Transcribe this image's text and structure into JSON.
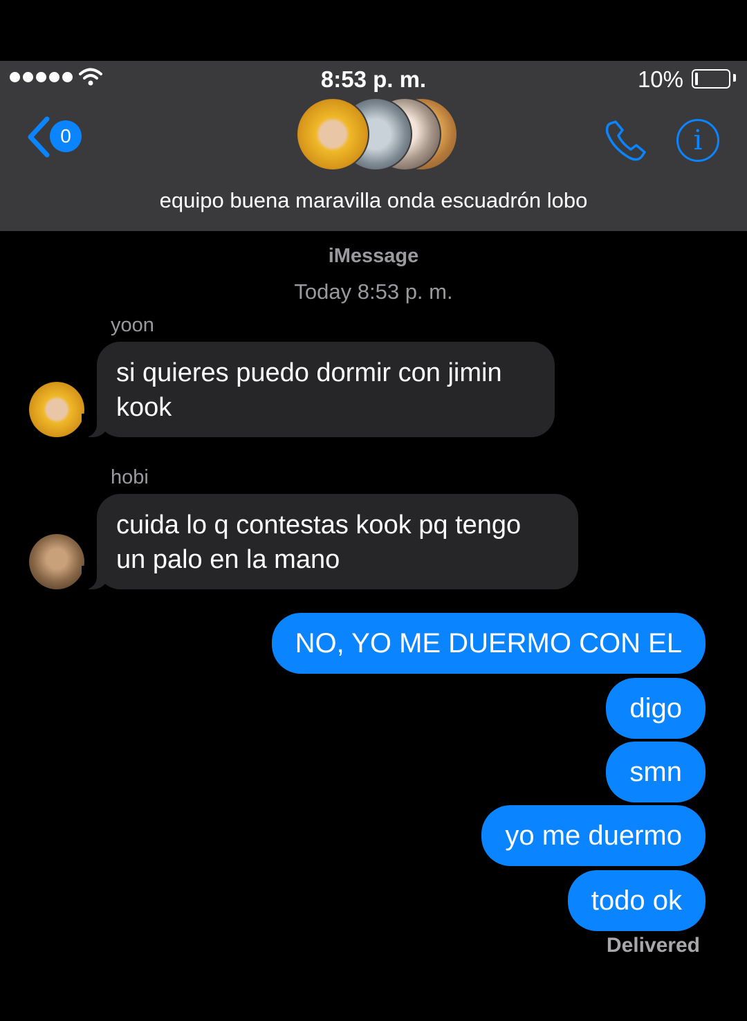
{
  "status_bar": {
    "time": "8:53 p. m.",
    "battery": "10%"
  },
  "nav": {
    "back_count": "0",
    "group_name": "equipo buena maravilla onda escuadrón lobo"
  },
  "conversation": {
    "service": "iMessage",
    "timestamp": "Today 8:53 p. m.",
    "incoming": [
      {
        "sender": "yoon",
        "text_line1": "si quieres puedo dormir con jimin",
        "text_line2": "kook"
      },
      {
        "sender": "hobi",
        "text_line1": "cuida lo q contestas kook pq tengo",
        "text_line2": "un palo en la mano"
      }
    ],
    "outgoing": [
      {
        "text": "NO, YO ME DUERMO CON EL"
      },
      {
        "text": "digo"
      },
      {
        "text": "smn"
      },
      {
        "text": "yo me duermo"
      },
      {
        "text": "todo ok"
      }
    ],
    "delivery_status": "Delivered"
  },
  "colors": {
    "accent": "#0a84ff",
    "header_bg": "#3a3a3c",
    "incoming_bubble": "#262629"
  },
  "icons": [
    "signal-dots-icon",
    "wifi-icon",
    "battery-icon",
    "back-chevron-icon",
    "phone-icon",
    "info-icon"
  ]
}
